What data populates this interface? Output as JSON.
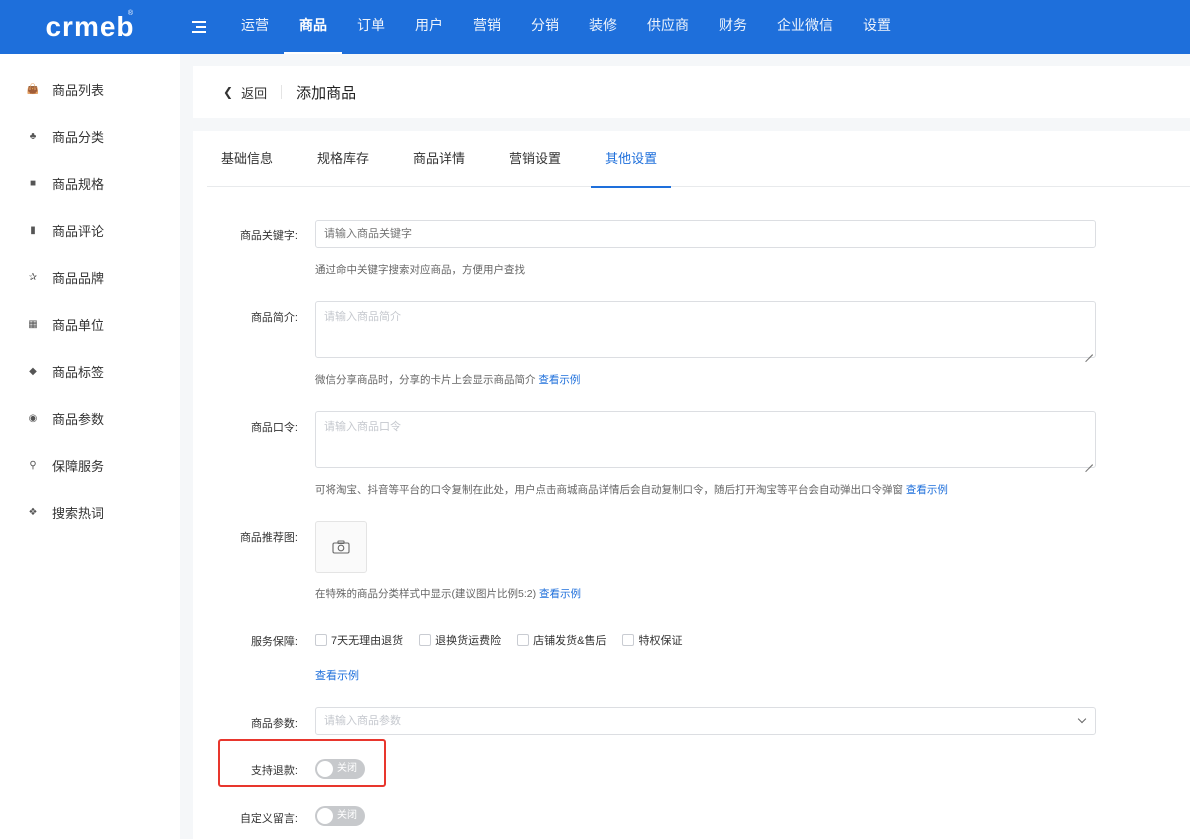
{
  "brand": {
    "logo_text": "crmeb",
    "registered": "®"
  },
  "topnav": {
    "items": [
      {
        "label": "运营",
        "active": false
      },
      {
        "label": "商品",
        "active": true
      },
      {
        "label": "订单",
        "active": false
      },
      {
        "label": "用户",
        "active": false
      },
      {
        "label": "营销",
        "active": false
      },
      {
        "label": "分销",
        "active": false
      },
      {
        "label": "装修",
        "active": false
      },
      {
        "label": "供应商",
        "active": false
      },
      {
        "label": "财务",
        "active": false
      },
      {
        "label": "企业微信",
        "active": false
      },
      {
        "label": "设置",
        "active": false
      }
    ]
  },
  "sidebar": {
    "items": [
      {
        "label": "商品列表",
        "icon": "basket-icon"
      },
      {
        "label": "商品分类",
        "icon": "cluster-icon"
      },
      {
        "label": "商品规格",
        "icon": "cube-icon"
      },
      {
        "label": "商品评论",
        "icon": "comment-icon"
      },
      {
        "label": "商品品牌",
        "icon": "brand-icon"
      },
      {
        "label": "商品单位",
        "icon": "grid-icon"
      },
      {
        "label": "商品标签",
        "icon": "tag-icon"
      },
      {
        "label": "商品参数",
        "icon": "eye-icon"
      },
      {
        "label": "保障服务",
        "icon": "person-icon"
      },
      {
        "label": "搜索热词",
        "icon": "globe-icon"
      }
    ]
  },
  "header": {
    "back_label": "返回",
    "title": "添加商品"
  },
  "tabs": [
    {
      "label": "基础信息",
      "active": false
    },
    {
      "label": "规格库存",
      "active": false
    },
    {
      "label": "商品详情",
      "active": false
    },
    {
      "label": "营销设置",
      "active": false
    },
    {
      "label": "其他设置",
      "active": true
    }
  ],
  "form": {
    "keyword": {
      "label": "商品关键字:",
      "placeholder": "请输入商品关键字",
      "help": "通过命中关键字搜索对应商品，方便用户查找"
    },
    "intro": {
      "label": "商品简介:",
      "placeholder": "请输入商品简介",
      "help": "微信分享商品时，分享的卡片上会显示商品简介",
      "link": "查看示例"
    },
    "command": {
      "label": "商品口令:",
      "placeholder": "请输入商品口令",
      "help": "可将淘宝、抖音等平台的口令复制在此处，用户点击商城商品详情后会自动复制口令，随后打开淘宝等平台会自动弹出口令弹窗",
      "link": "查看示例"
    },
    "recommend_image": {
      "label": "商品推荐图:",
      "help": "在特殊的商品分类样式中显示(建议图片比例5:2)",
      "link": "查看示例"
    },
    "service": {
      "label": "服务保障:",
      "options": [
        "7天无理由退货",
        "退换货运费险",
        "店铺发货&售后",
        "特权保证"
      ],
      "link": "查看示例"
    },
    "params": {
      "label": "商品参数:",
      "placeholder": "请输入商品参数"
    },
    "refund": {
      "label": "支持退款:",
      "switch_text": "关闭",
      "on": false
    },
    "custom_message": {
      "label": "自定义留言:",
      "switch_text": "关闭",
      "on": false
    }
  },
  "colors": {
    "primary": "#1e6fdb",
    "highlight": "#e8362d"
  }
}
